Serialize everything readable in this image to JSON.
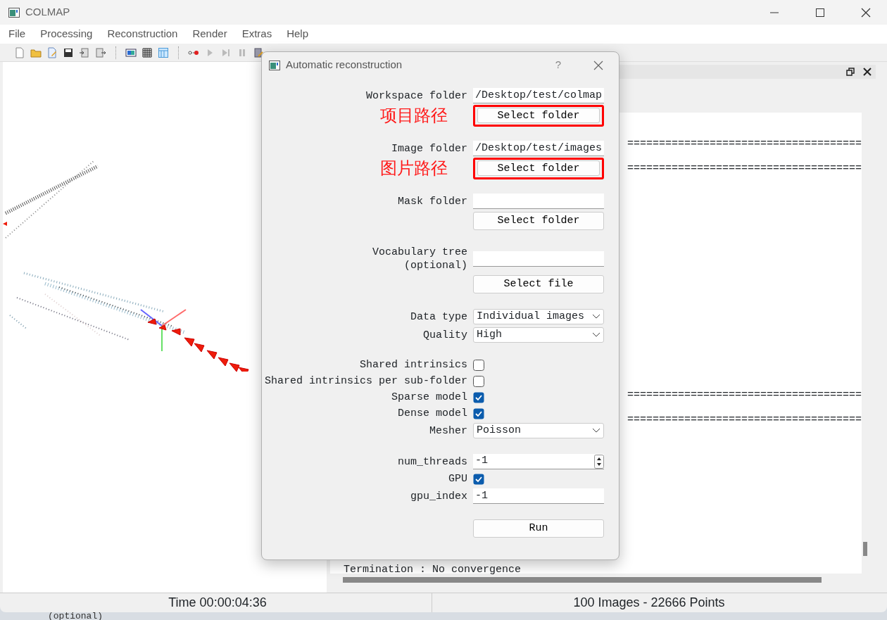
{
  "window": {
    "title": "COLMAP"
  },
  "menu": [
    {
      "label": "File"
    },
    {
      "label": "Processing"
    },
    {
      "label": "Reconstruction"
    },
    {
      "label": "Render"
    },
    {
      "label": "Extras"
    },
    {
      "label": "Help"
    }
  ],
  "log_panel": {
    "blocks": [
      {
        "lines": [
          {
            "kind": "rule",
            "text": "====================================="
          },
          {
            "kind": "rule",
            "text": "====================================="
          }
        ]
      },
      {
        "lines": [
          {
            "kind": "rule",
            "text": "====================================="
          },
          {
            "kind": "rule",
            "text": "====================================="
          }
        ]
      },
      {
        "lines": [
          {
            "kind": "text",
            "text": "Termination : No convergence"
          }
        ]
      }
    ]
  },
  "status_bar": {
    "time": "Time 00:00:04:36",
    "summary": "100 Images - 22666 Points"
  },
  "background_window": {
    "text": "(optional)"
  },
  "dialog": {
    "title": "Automatic reconstruction",
    "help": "?",
    "groups": [
      {
        "rows": [
          {
            "kind": "field",
            "label": "Workspace folder",
            "value": "/Desktop/test/colmap"
          },
          {
            "kind": "button",
            "label": "Select folder",
            "highlighted": true,
            "note": "项目路径"
          }
        ]
      },
      {
        "rows": [
          {
            "kind": "field",
            "label": "Image folder",
            "value": "/Desktop/test/images"
          },
          {
            "kind": "button",
            "label": "Select folder",
            "highlighted": true,
            "note": "图片路径"
          }
        ]
      },
      {
        "rows": [
          {
            "kind": "field",
            "label": "Mask folder"
          },
          {
            "kind": "button",
            "label": "Select folder",
            "highlighted": false
          }
        ]
      },
      {
        "rows": [
          {
            "kind": "field",
            "label": "Vocabulary tree\n(optional)"
          },
          {
            "kind": "button",
            "label": "Select file",
            "highlighted": false
          }
        ]
      },
      {
        "rows": [
          {
            "kind": "select",
            "label": "Data type",
            "value": "Individual images"
          },
          {
            "kind": "select",
            "label": "Quality",
            "value": "High"
          }
        ]
      },
      {
        "rows": [
          {
            "kind": "check",
            "label": "Shared intrinsics",
            "checked": false
          },
          {
            "kind": "check",
            "label": "Shared intrinsics per sub-folder",
            "checked": false
          },
          {
            "kind": "check",
            "label": "Sparse model",
            "checked": true
          },
          {
            "kind": "check",
            "label": "Dense model",
            "checked": true
          },
          {
            "kind": "select",
            "label": "Mesher",
            "value": "Poisson"
          }
        ]
      },
      {
        "rows": [
          {
            "kind": "spin",
            "label": "num_threads",
            "value": "-1"
          },
          {
            "kind": "check",
            "label": "GPU",
            "checked": true
          },
          {
            "kind": "field",
            "label": "gpu_index",
            "value": "-1"
          }
        ]
      },
      {
        "rows": [
          {
            "kind": "button",
            "label": "Run",
            "highlighted": false
          }
        ]
      }
    ]
  }
}
